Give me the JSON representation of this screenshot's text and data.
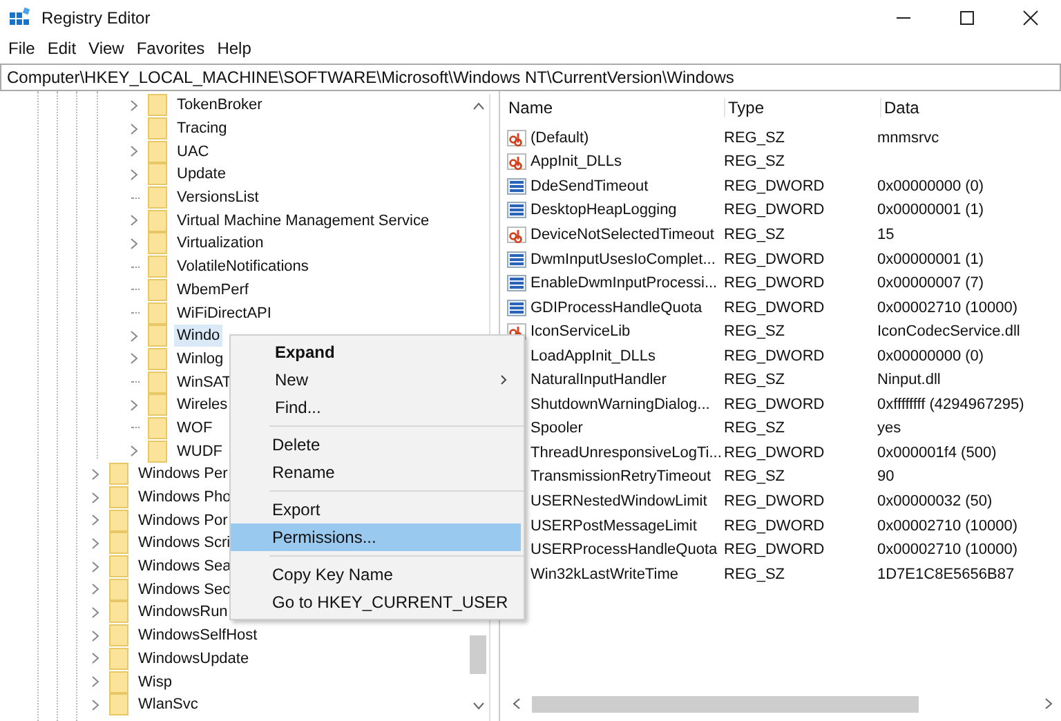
{
  "window": {
    "title": "Registry Editor"
  },
  "menu_bar": [
    "File",
    "Edit",
    "View",
    "Favorites",
    "Help"
  ],
  "address": "Computer\\HKEY_LOCAL_MACHINE\\SOFTWARE\\Microsoft\\Windows NT\\CurrentVersion\\Windows",
  "tree": {
    "continued_children": [
      {
        "label": "TokenBroker",
        "expandable": true,
        "selected": false
      },
      {
        "label": "Tracing",
        "expandable": true,
        "selected": false
      },
      {
        "label": "UAC",
        "expandable": true,
        "selected": false
      },
      {
        "label": "Update",
        "expandable": true,
        "selected": false
      },
      {
        "label": "VersionsList",
        "expandable": false,
        "selected": false
      },
      {
        "label": "Virtual Machine Management Service",
        "expandable": true,
        "selected": false
      },
      {
        "label": "Virtualization",
        "expandable": true,
        "selected": false
      },
      {
        "label": "VolatileNotifications",
        "expandable": false,
        "selected": false
      },
      {
        "label": "WbemPerf",
        "expandable": false,
        "selected": false
      },
      {
        "label": "WiFiDirectAPI",
        "expandable": false,
        "selected": false
      },
      {
        "label": "Windo",
        "expandable": true,
        "selected": true
      },
      {
        "label": "Winlog",
        "expandable": true,
        "selected": false
      },
      {
        "label": "WinSAT",
        "expandable": false,
        "selected": false
      },
      {
        "label": "Wireles",
        "expandable": true,
        "selected": false
      },
      {
        "label": "WOF",
        "expandable": false,
        "selected": false
      },
      {
        "label": "WUDF",
        "expandable": true,
        "selected": false
      }
    ],
    "items": [
      {
        "label": "Windows Per",
        "expandable": true,
        "selected": false
      },
      {
        "label": "Windows Pho",
        "expandable": true,
        "selected": false
      },
      {
        "label": "Windows Por",
        "expandable": true,
        "selected": false
      },
      {
        "label": "Windows Scri",
        "expandable": true,
        "selected": false
      },
      {
        "label": "Windows Sea",
        "expandable": true,
        "selected": false
      },
      {
        "label": "Windows Sec",
        "expandable": true,
        "selected": false
      },
      {
        "label": "WindowsRun",
        "expandable": true,
        "selected": false
      },
      {
        "label": "WindowsSelfHost",
        "expandable": true,
        "selected": false
      },
      {
        "label": "WindowsUpdate",
        "expandable": true,
        "selected": false
      },
      {
        "label": "Wisp",
        "expandable": true,
        "selected": false
      },
      {
        "label": "WlanSvc",
        "expandable": true,
        "selected": false
      }
    ]
  },
  "values": {
    "columns": [
      "Name",
      "Type",
      "Data"
    ],
    "rows": [
      {
        "kind": "string",
        "name": "(Default)",
        "type": "REG_SZ",
        "data": "mnmsrvc"
      },
      {
        "kind": "string",
        "name": "AppInit_DLLs",
        "type": "REG_SZ"
      },
      {
        "kind": "binary",
        "name": "DdeSendTimeout",
        "type": "REG_DWORD",
        "data": "0x00000000 (0)"
      },
      {
        "kind": "binary",
        "name": "DesktopHeapLogging",
        "type": "REG_DWORD",
        "data": "0x00000001 (1)"
      },
      {
        "kind": "string",
        "name": "DeviceNotSelectedTimeout",
        "type": "REG_SZ",
        "data": "15"
      },
      {
        "kind": "binary",
        "name": "DwmInputUsesIoComplet...",
        "type": "REG_DWORD",
        "data": "0x00000001 (1)"
      },
      {
        "kind": "binary",
        "name": "EnableDwmInputProcessi...",
        "type": "REG_DWORD",
        "data": "0x00000007 (7)"
      },
      {
        "kind": "binary",
        "name": "GDIProcessHandleQuota",
        "type": "REG_DWORD",
        "data": "0x00002710 (10000)"
      },
      {
        "kind": "string",
        "name": "IconServiceLib",
        "type": "REG_SZ",
        "data": "IconCodecService.dll"
      },
      {
        "name": "LoadAppInit_DLLs",
        "type": "REG_DWORD",
        "data": "0x00000000 (0)"
      },
      {
        "name": "NaturalInputHandler",
        "type": "REG_SZ",
        "data": "Ninput.dll"
      },
      {
        "name": "ShutdownWarningDialog...",
        "type": "REG_DWORD",
        "data": "0xffffffff (4294967295)"
      },
      {
        "name": "Spooler",
        "type": "REG_SZ",
        "data": "yes"
      },
      {
        "name": "ThreadUnresponsiveLogTi...",
        "type": "REG_DWORD",
        "data": "0x000001f4 (500)"
      },
      {
        "name": "TransmissionRetryTimeout",
        "type": "REG_SZ",
        "data": "90"
      },
      {
        "name": "USERNestedWindowLimit",
        "type": "REG_DWORD",
        "data": "0x00000032 (50)"
      },
      {
        "name": "USERPostMessageLimit",
        "type": "REG_DWORD",
        "data": "0x00002710 (10000)"
      },
      {
        "name": "USERProcessHandleQuota",
        "type": "REG_DWORD",
        "data": "0x00002710 (10000)"
      },
      {
        "name": "Win32kLastWriteTime",
        "type": "REG_SZ",
        "data": "1D7E1C8E5656B87"
      }
    ]
  },
  "context_menu": {
    "groups": [
      [
        {
          "label": "Expand",
          "default": true,
          "submenu": false,
          "selected": false
        },
        {
          "label": "New",
          "default": false,
          "submenu": true,
          "selected": false
        },
        {
          "label": "Find...",
          "default": false,
          "submenu": false,
          "selected": false
        }
      ],
      [
        {
          "label": "Delete",
          "default": false,
          "submenu": false,
          "selected": false
        },
        {
          "label": "Rename",
          "default": false,
          "submenu": false,
          "selected": false
        }
      ],
      [
        {
          "label": "Export",
          "default": false,
          "submenu": false,
          "selected": false
        },
        {
          "label": "Permissions...",
          "default": false,
          "submenu": false,
          "selected": true
        }
      ],
      [
        {
          "label": "Copy Key Name",
          "default": false,
          "submenu": false,
          "selected": false
        },
        {
          "label": "Go to HKEY_CURRENT_USER",
          "default": false,
          "submenu": false,
          "selected": false
        }
      ]
    ]
  }
}
